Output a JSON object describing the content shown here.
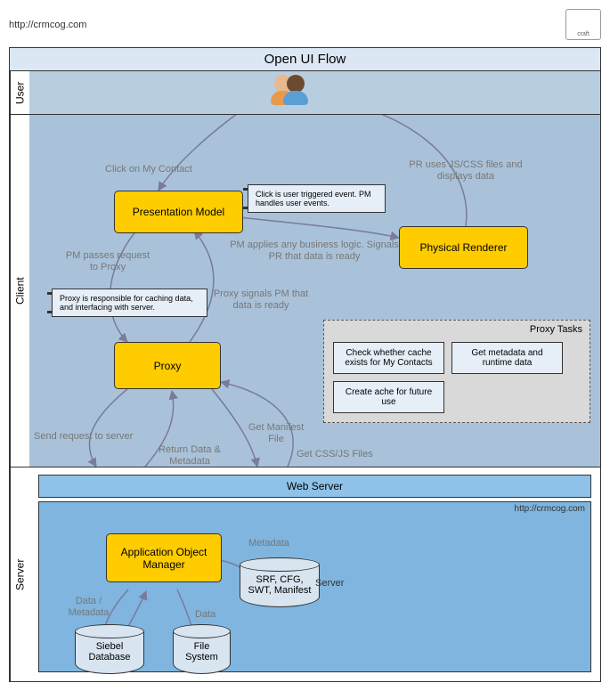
{
  "meta": {
    "url": "http://crmcog.com",
    "title": "Open UI Flow",
    "logo_text": "craft"
  },
  "lanes": {
    "user": "User",
    "client": "Client",
    "server": "Server"
  },
  "nodes": {
    "pm": "Presentation Model",
    "pr": "Physical Renderer",
    "proxy": "Proxy",
    "aom": "Application Object Manager",
    "srf": "SRF, CFG, SWT, Manifest",
    "srf_suffix": "Server",
    "siebel_db": "Siebel Database",
    "file_system": "File System",
    "web_server": "Web Server"
  },
  "notes": {
    "pm_note": "Click is user triggered event. PM handles user events.",
    "proxy_note": "Proxy is responsible for caching data, and interfacing with server."
  },
  "edges": {
    "user_click": "Click on My Contact",
    "pr_display": "PR uses JS/CSS files and displays data",
    "pm_to_pr": "PM applies any business logic. Signals PR that data is ready",
    "pm_to_proxy": "PM passes request to Proxy",
    "proxy_to_pm": "Proxy signals PM that data is ready",
    "send_to_server": "Send request to server",
    "return_data": "Return Data & Metadata",
    "get_manifest": "Get Manifest File",
    "get_cssjs": "Get CSS/JS Files",
    "metadata": "Metadata",
    "data_meta": "Data / Metadata",
    "data": "Data"
  },
  "proxy_tasks": {
    "title": "Proxy Tasks",
    "items": [
      "Check whether cache exists for My Contacts",
      "Get metadata and runtime data",
      "Create ache for future use"
    ]
  },
  "server_inner_url": "http://crmcog.com"
}
